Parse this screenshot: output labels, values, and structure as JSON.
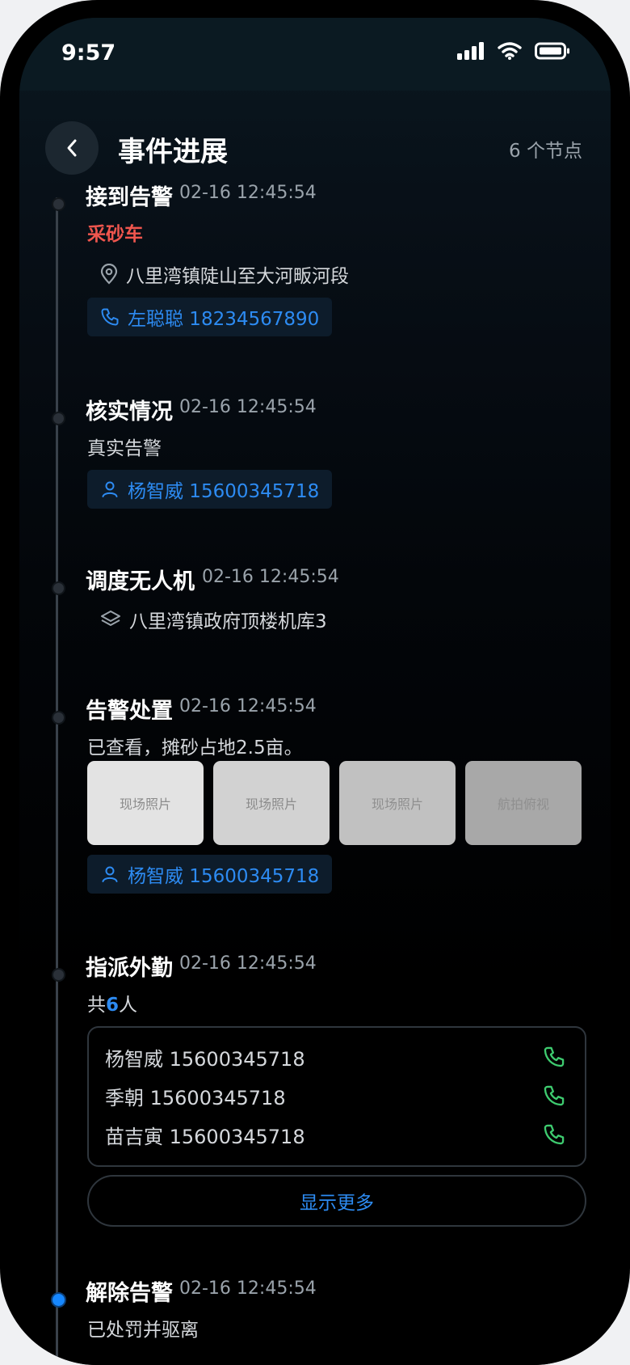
{
  "status": {
    "time": "9:57"
  },
  "header": {
    "title": "事件进展",
    "node_count": "6 个节点"
  },
  "timeline": [
    {
      "title": "接到告警",
      "time": "02-16 12:45:54",
      "highlight": "采砂车",
      "location": "八里湾镇陡山至大河畈河段",
      "contact": "左聪聪 18234567890"
    },
    {
      "title": "核实情况",
      "time": "02-16 12:45:54",
      "text": "真实告警",
      "contact": "杨智威 15600345718"
    },
    {
      "title": "调度无人机",
      "time": "02-16 12:45:54",
      "hangar": "八里湾镇政府顶楼机库3"
    },
    {
      "title": "告警处置",
      "time": "02-16 12:45:54",
      "text": "已查看，摊砂占地2.5亩。",
      "photos": [
        "现场照片",
        "现场照片",
        "现场照片",
        "航拍俯视"
      ],
      "contact": "杨智威 15600345718"
    },
    {
      "title": "指派外勤",
      "time": "02-16 12:45:54",
      "count_prefix": "共",
      "count": "6",
      "count_suffix": "人",
      "people": [
        "杨智威 15600345718",
        "季朝 15600345718",
        "苗吉寅 15600345718"
      ],
      "more": "显示更多"
    },
    {
      "title": "解除告警",
      "time": "02-16 12:45:54",
      "text": "已处罚并驱离"
    }
  ]
}
